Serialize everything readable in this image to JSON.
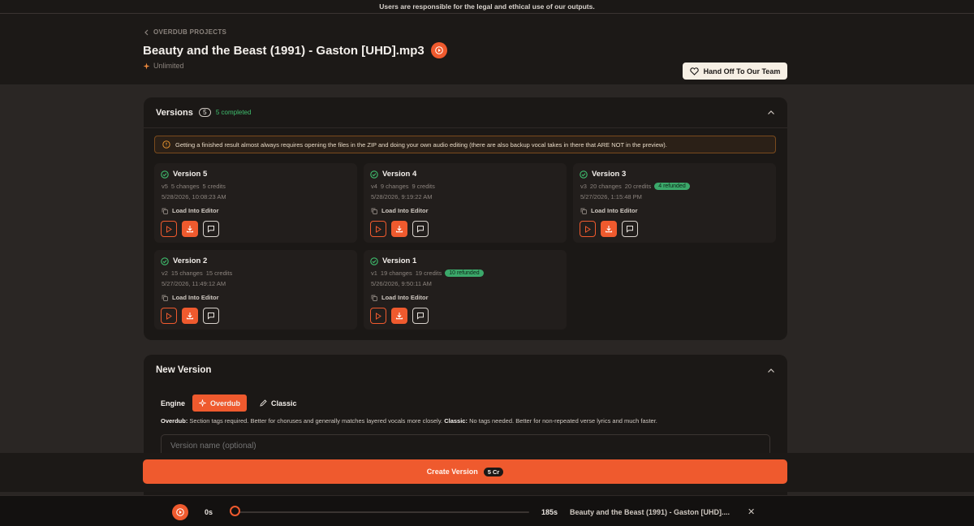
{
  "notice": "Users are responsible for the legal and ethical use of our outputs.",
  "header": {
    "breadcrumb": "OVERDUB PROJECTS",
    "title": "Beauty and the Beast (1991) - Gaston [UHD].mp3",
    "plan": "Unlimited",
    "handoff_label": "Hand Off To Our Team"
  },
  "versions": {
    "title": "Versions",
    "count": "5",
    "completed": "5 completed",
    "warning": "Getting a finished result almost always requires opening the files in the ZIP and doing your own audio editing (there are also backup vocal takes in there that ARE NOT in the preview).",
    "load_label": "Load Into Editor",
    "items": [
      {
        "name": "Version 5",
        "tag": "v5",
        "changes": "5 changes",
        "credits": "5 credits",
        "refund": "",
        "date": "5/28/2026, 10:08:23 AM"
      },
      {
        "name": "Version 4",
        "tag": "v4",
        "changes": "9 changes",
        "credits": "9 credits",
        "refund": "",
        "date": "5/28/2026, 9:19:22 AM"
      },
      {
        "name": "Version 3",
        "tag": "v3",
        "changes": "20 changes",
        "credits": "20 credits",
        "refund": "4 refunded",
        "date": "5/27/2026, 1:15:48 PM"
      },
      {
        "name": "Version 2",
        "tag": "v2",
        "changes": "15 changes",
        "credits": "15 credits",
        "refund": "",
        "date": "5/27/2026, 11:49:12 AM"
      },
      {
        "name": "Version 1",
        "tag": "v1",
        "changes": "19 changes",
        "credits": "19 credits",
        "refund": "10 refunded",
        "date": "5/26/2026, 9:50:11 AM"
      }
    ]
  },
  "new_version": {
    "title": "New Version",
    "engine_label": "Engine",
    "engines": [
      {
        "label": "Overdub",
        "active": true
      },
      {
        "label": "Classic",
        "active": false
      }
    ],
    "desc_overdub_label": "Overdub:",
    "desc_overdub": " Section tags required. Better for choruses and generally matches layered vocals more closely. ",
    "desc_classic_label": "Classic:",
    "desc_classic": " No tags needed. Better for non-repeated verse lyrics and much faster.",
    "name_placeholder": "Version name (optional)"
  },
  "create": {
    "label": "Create Version",
    "cost": "5 Cr"
  },
  "player": {
    "current": "0s",
    "total": "185s",
    "progress": 0,
    "track_name": "Beauty and the Beast (1991) - Gaston [UHD]...."
  },
  "colors": {
    "accent": "#ef5a2e",
    "success": "#3fbf6e",
    "background": "#2a2624",
    "card": "#1b1816"
  }
}
